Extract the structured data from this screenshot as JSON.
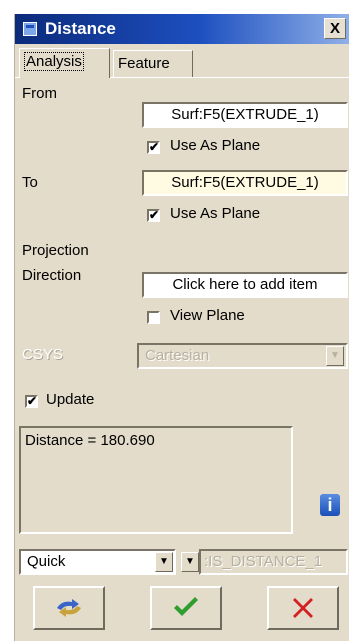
{
  "window": {
    "title": "Distance",
    "close_label": "X"
  },
  "tabs": [
    {
      "label": "Analysis",
      "active": true
    },
    {
      "label": "Feature",
      "active": false
    }
  ],
  "from": {
    "label": "From",
    "value": "Surf:F5(EXTRUDE_1)",
    "use_as_plane_label": "Use As Plane",
    "use_as_plane_checked": true
  },
  "to": {
    "label": "To",
    "value": "Surf:F5(EXTRUDE_1)",
    "use_as_plane_label": "Use As Plane",
    "use_as_plane_checked": true
  },
  "projection": {
    "label_line1": "Projection",
    "label_line2": "Direction",
    "value": "Click here to add item",
    "view_plane_label": "View Plane",
    "view_plane_checked": false
  },
  "csys": {
    "label": "CSYS",
    "value": "Cartesian"
  },
  "update": {
    "label": "Update",
    "checked": true
  },
  "result": {
    "text": "Distance = 180.690"
  },
  "bottom": {
    "mode_value": "Quick",
    "name_value": ":IS_DISTANCE_1"
  },
  "colors": {
    "accent": "#1d4fc0",
    "ok_green": "#2e9e2e",
    "cancel_red": "#d42020",
    "yellow_field": "#fffbe2"
  },
  "icons": {
    "title": "window-icon",
    "info": "info-icon",
    "repeat": "repeat-icon",
    "ok": "checkmark-icon",
    "cancel": "cross-icon"
  }
}
